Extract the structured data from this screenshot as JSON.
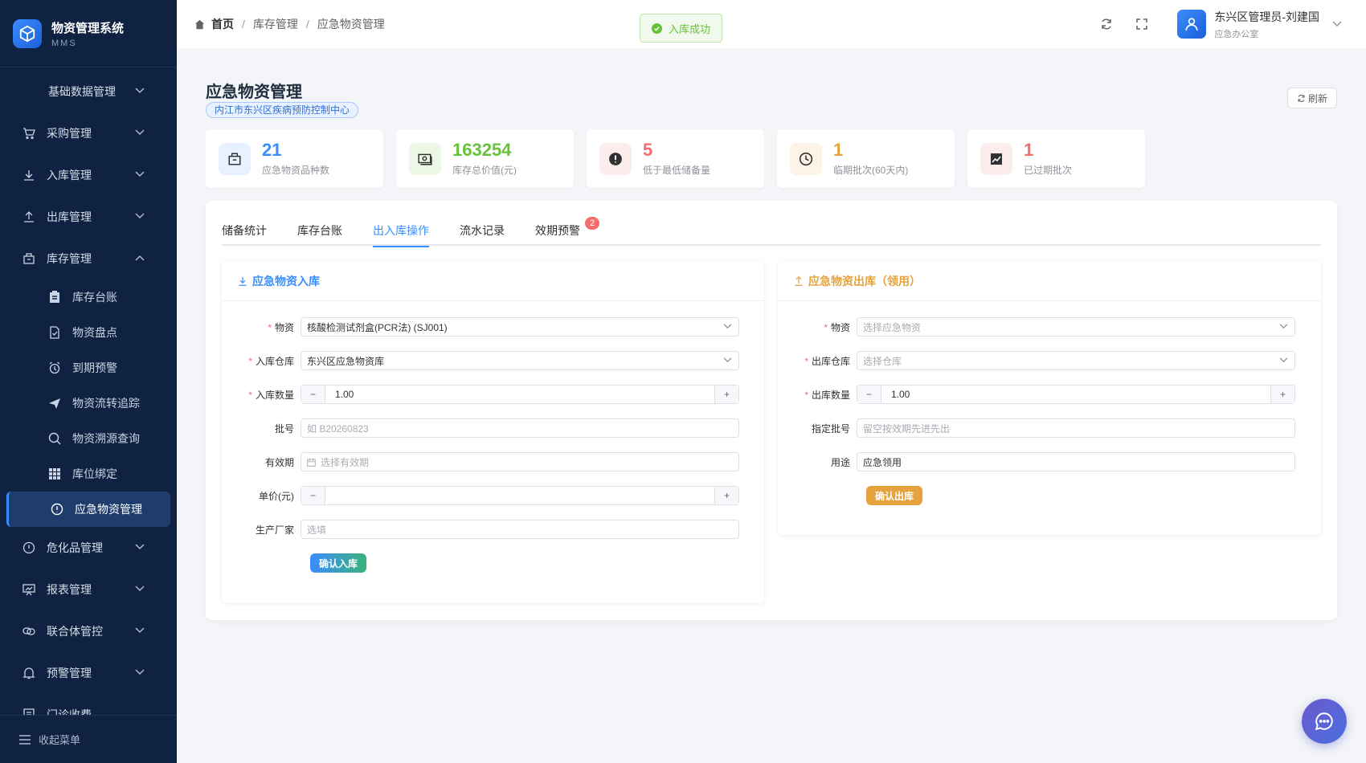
{
  "app": {
    "title": "物资管理系统",
    "subtitle": "MMS"
  },
  "sidebar": {
    "menu": [
      {
        "label": "基础数据管理",
        "icon": "database-icon"
      },
      {
        "label": "采购管理",
        "icon": "cart-icon"
      },
      {
        "label": "入库管理",
        "icon": "download-icon"
      },
      {
        "label": "出库管理",
        "icon": "upload-icon"
      },
      {
        "label": "库存管理",
        "icon": "box-icon",
        "expanded": true
      }
    ],
    "submenu": [
      {
        "label": "库存台账",
        "icon": "clipboard-icon"
      },
      {
        "label": "物资盘点",
        "icon": "check-doc-icon"
      },
      {
        "label": "到期预警",
        "icon": "alarm-icon"
      },
      {
        "label": "物资流转追踪",
        "icon": "send-icon"
      },
      {
        "label": "物资溯源查询",
        "icon": "search-icon"
      },
      {
        "label": "库位绑定",
        "icon": "grid-icon"
      },
      {
        "label": "应急物资管理",
        "icon": "alert-circle-icon",
        "active": true
      }
    ],
    "menu2": [
      {
        "label": "危化品管理",
        "icon": "warning-icon"
      },
      {
        "label": "报表管理",
        "icon": "report-icon"
      },
      {
        "label": "联合体管控",
        "icon": "link-icon"
      },
      {
        "label": "预警管理",
        "icon": "bell-icon"
      },
      {
        "label": "门诊收费",
        "icon": "receipt-icon"
      }
    ],
    "collapse_label": "收起菜单"
  },
  "header": {
    "breadcrumb": [
      "首页",
      "库存管理",
      "应急物资管理"
    ],
    "toast": "入库成功",
    "user_name": "东兴区管理员-刘建国",
    "user_dept": "应急办公室"
  },
  "page": {
    "title": "应急物资管理",
    "org": "内江市东兴区疾病预防控制中心",
    "refresh_label": "刷新"
  },
  "stats": [
    {
      "value": "21",
      "label": "应急物资品种数",
      "color": "#3a8dff",
      "bg": "#e8f1ff",
      "icon": "package-icon"
    },
    {
      "value": "163254",
      "label": "库存总价值(元)",
      "color": "#67c23a",
      "bg": "#ecf7e6",
      "icon": "money-icon"
    },
    {
      "value": "5",
      "label": "低于最低储备量",
      "color": "#f56c6c",
      "bg": "#fdecec",
      "icon": "alert-icon"
    },
    {
      "value": "1",
      "label": "临期批次(60天内)",
      "color": "#e6a23c",
      "bg": "#fdf3e6",
      "icon": "clock-icon"
    },
    {
      "value": "1",
      "label": "已过期批次",
      "color": "#f56c6c",
      "bg": "#fdecec",
      "icon": "trend-icon"
    }
  ],
  "tabs": [
    {
      "label": "储备统计"
    },
    {
      "label": "库存台账"
    },
    {
      "label": "出入库操作",
      "active": true
    },
    {
      "label": "流水记录"
    },
    {
      "label": "效期预警",
      "badge": "2"
    }
  ],
  "inbound": {
    "title": "应急物资入库",
    "fields": {
      "material": {
        "label": "物资",
        "value": "核酸检测试剂盒(PCR法) (SJ001)"
      },
      "warehouse": {
        "label": "入库仓库",
        "value": "东兴区应急物资库"
      },
      "quantity": {
        "label": "入库数量",
        "value": "1.00"
      },
      "batch": {
        "label": "批号",
        "placeholder": "如 B20260823"
      },
      "expiry": {
        "label": "有效期",
        "placeholder": "选择有效期"
      },
      "price": {
        "label": "单价(元)",
        "value": ""
      },
      "maker": {
        "label": "生产厂家",
        "placeholder": "选填"
      }
    },
    "submit": "确认入库"
  },
  "outbound": {
    "title": "应急物资出库（领用）",
    "fields": {
      "material": {
        "label": "物资",
        "placeholder": "选择应急物资"
      },
      "warehouse": {
        "label": "出库仓库",
        "placeholder": "选择仓库"
      },
      "quantity": {
        "label": "出库数量",
        "value": "1.00"
      },
      "batch": {
        "label": "指定批号",
        "placeholder": "留空按效期先进先出"
      },
      "purpose": {
        "label": "用途",
        "value": "应急领用"
      }
    },
    "submit": "确认出库"
  },
  "colors": {
    "accent": "#3a8dff",
    "sidebar": "#0f2241",
    "warning": "#e6a23c",
    "success": "#67c23a",
    "danger": "#f56c6c"
  }
}
